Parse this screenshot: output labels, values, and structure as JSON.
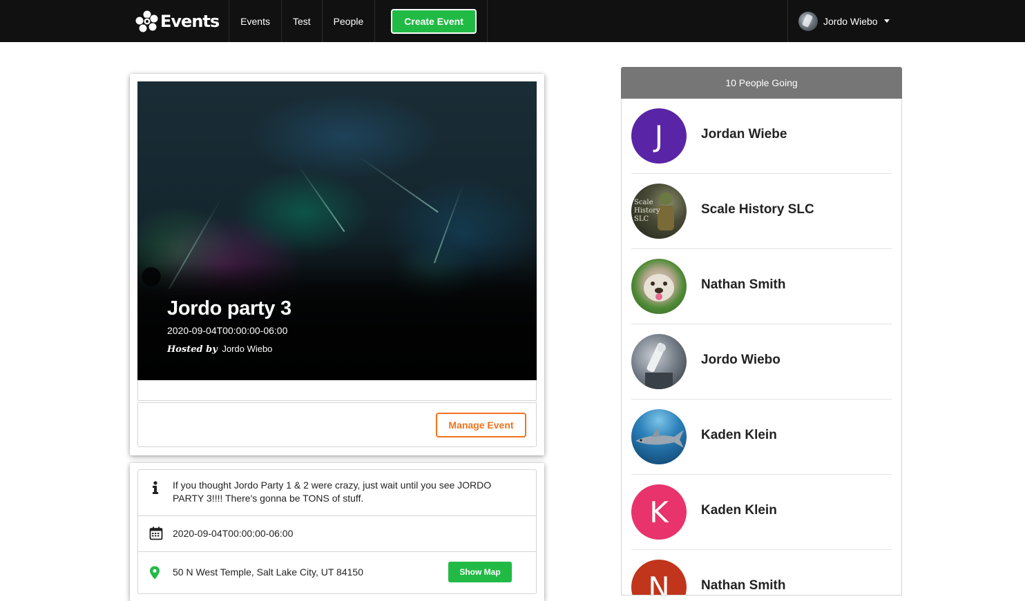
{
  "nav": {
    "brand": "Events",
    "items": [
      "Events",
      "Test",
      "People"
    ],
    "create_label": "Create Event",
    "user_name": "Jordo Wiebo"
  },
  "event": {
    "title": "Jordo party 3",
    "date": "2020-09-04T00:00:00-06:00",
    "hosted_prefix": "Hosted by",
    "host": "Jordo Wiebo",
    "manage_label": "Manage Event",
    "description": "If you thought Jordo Party 1 & 2 were crazy, just wait until you see JORDO PARTY 3!!!! There's gonna be TONS of stuff.",
    "venue": "50 N West Temple, Salt Lake City, UT 84150",
    "show_map_label": "Show Map"
  },
  "attendees": {
    "header": "10 People Going",
    "list": [
      {
        "name": "Jordan Wiebe",
        "initial": "J",
        "color": "#5a24a6"
      },
      {
        "name": "Scale History SLC",
        "initial": "",
        "color": "#3d4030",
        "avatar_text": "Scale History SLC"
      },
      {
        "name": "Nathan Smith",
        "initial": "",
        "color": "#3f7a2f"
      },
      {
        "name": "Jordo Wiebo",
        "initial": "",
        "color": "#5d6670"
      },
      {
        "name": "Kaden Klein",
        "initial": "",
        "color": "#1a5a8a"
      },
      {
        "name": "Kaden Klein",
        "initial": "K",
        "color": "#e8336d"
      },
      {
        "name": "Nathan Smith",
        "initial": "N",
        "color": "#c0351c"
      }
    ]
  },
  "colors": {
    "accent_green": "#21ba45",
    "accent_orange": "#f2711c",
    "navbar": "#111111",
    "attendee_header": "#767676"
  },
  "icons": [
    "info-icon",
    "calendar-icon",
    "map-marker-icon",
    "caret-down-icon",
    "logo-flower-icon"
  ]
}
